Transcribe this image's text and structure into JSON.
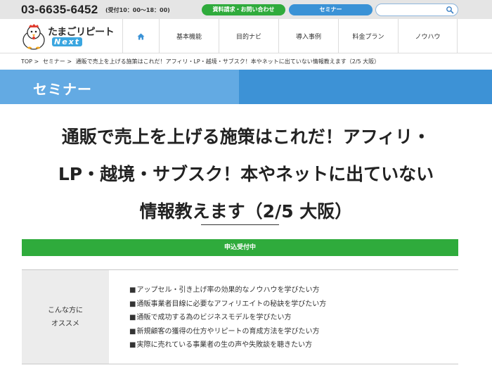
{
  "topbar": {
    "phone": "03-6635-6452",
    "hours": "(受付10：00〜18：00)",
    "contact_button": "資料請求・お問い合わせ",
    "seminar_button": "セミナー",
    "search_placeholder": ""
  },
  "logo": {
    "text": "たまごリピート",
    "sub": "Next"
  },
  "nav": {
    "items": [
      {
        "label": "基本機能"
      },
      {
        "label": "目的ナビ"
      },
      {
        "label": "導入事例"
      },
      {
        "label": "料金プラン"
      },
      {
        "label": "ノウハウ"
      }
    ]
  },
  "breadcrumb": {
    "items": [
      "TOP >",
      "セミナー >",
      "通販で売上を上げる施策はこれだ！アフィリ・LP・越境・サブスク！本やネットに出ていない情報教えます（2/5 大阪）"
    ]
  },
  "page": {
    "section_title": "セミナー",
    "headline_lines": [
      "通販で売上を上げる施策はこれだ！アフィリ・",
      "LP・越境・サブスク！本やネットに出ていない",
      "情報教えます（2/5 大阪）"
    ],
    "status": "申込受付中"
  },
  "recommend": {
    "heading_line1": "こんな方に",
    "heading_line2": "オススメ",
    "items": [
      "アップセル・引き上げ率の効果的なノウハウを学びたい方",
      "通販事業者目線に必要なアフィリエイトの秘訣を学びたい方",
      "通販で成功する為のビジネスモデルを学びたい方",
      "新規顧客の獲得の仕方やリピートの育成方法を学びたい方",
      "実際に売れている事業者の生の声や失敗談を聴きたい方"
    ]
  },
  "colors": {
    "green": "#2fab3c",
    "blue": "#3d92d6",
    "light_blue": "#63aae3"
  },
  "icons": {
    "search": "search-icon",
    "home": "home-icon",
    "logo": "chicken-logo-icon"
  }
}
